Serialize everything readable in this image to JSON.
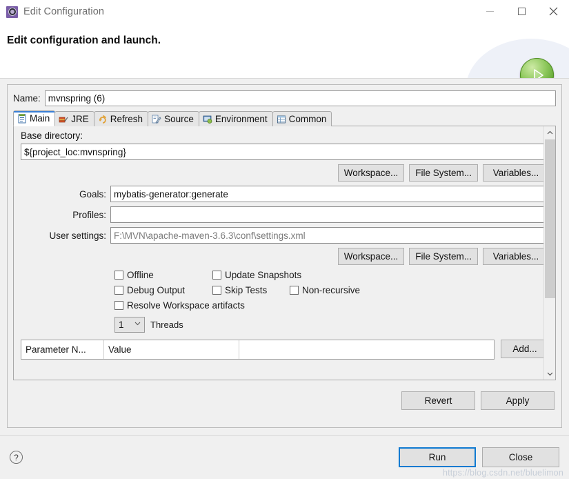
{
  "window": {
    "title": "Edit Configuration",
    "app_icon": "gear-icon",
    "minimize": "minimize-icon",
    "maximize": "maximize-icon",
    "close": "close-icon"
  },
  "header": {
    "title": "Edit configuration and launch.",
    "badge_icon": "run-play-icon"
  },
  "name": {
    "label": "Name:",
    "value": "mvnspring (6)"
  },
  "tabs": [
    {
      "label": "Main",
      "icon": "main-tab-icon",
      "active": true
    },
    {
      "label": "JRE",
      "icon": "jre-tab-icon",
      "active": false
    },
    {
      "label": "Refresh",
      "icon": "refresh-tab-icon",
      "active": false
    },
    {
      "label": "Source",
      "icon": "source-tab-icon",
      "active": false
    },
    {
      "label": "Environment",
      "icon": "environment-tab-icon",
      "active": false
    },
    {
      "label": "Common",
      "icon": "common-tab-icon",
      "active": false
    }
  ],
  "main_tab": {
    "base_directory": {
      "label": "Base directory:",
      "value": "${project_loc:mvnspring}"
    },
    "browse_buttons_top": [
      {
        "label": "Workspace..."
      },
      {
        "label": "File System..."
      },
      {
        "label": "Variables..."
      }
    ],
    "goals": {
      "label": "Goals:",
      "value": "mybatis-generator:generate"
    },
    "profiles": {
      "label": "Profiles:",
      "value": ""
    },
    "user_settings": {
      "label": "User settings:",
      "value": "F:\\MVN\\apache-maven-3.6.3\\conf\\settings.xml"
    },
    "browse_buttons_bottom": [
      {
        "label": "Workspace..."
      },
      {
        "label": "File System..."
      },
      {
        "label": "Variables..."
      }
    ],
    "checkbox_rows": [
      [
        {
          "label": "Offline",
          "checked": false
        },
        {
          "label": "Update Snapshots",
          "checked": false
        }
      ],
      [
        {
          "label": "Debug Output",
          "checked": false
        },
        {
          "label": "Skip Tests",
          "checked": false
        },
        {
          "label": "Non-recursive",
          "checked": false
        }
      ],
      [
        {
          "label": "Resolve Workspace artifacts",
          "checked": false
        }
      ]
    ],
    "threads": {
      "value": "1",
      "label": "Threads",
      "dropdown_icon": "chevron-down-icon"
    },
    "parameter_table": {
      "columns": [
        "Parameter N...",
        "Value",
        ""
      ],
      "rows": []
    },
    "add_button": "Add...",
    "scrollbar": {
      "up_icon": "chevron-up-icon",
      "down_icon": "chevron-down-icon"
    }
  },
  "apply_bar": {
    "revert": "Revert",
    "apply": "Apply"
  },
  "footer": {
    "help_icon": "help-icon",
    "help_glyph": "?",
    "run": "Run",
    "close": "Close",
    "watermark": "https://blog.csdn.net/bluelimon"
  },
  "colors": {
    "accent_blue": "#0f7ad1",
    "tab_active_underline": "#3a7fd5",
    "run_green": "#5da32f",
    "dialog_bg": "#f0f0f0",
    "muted_text": "#7b7b7b"
  }
}
